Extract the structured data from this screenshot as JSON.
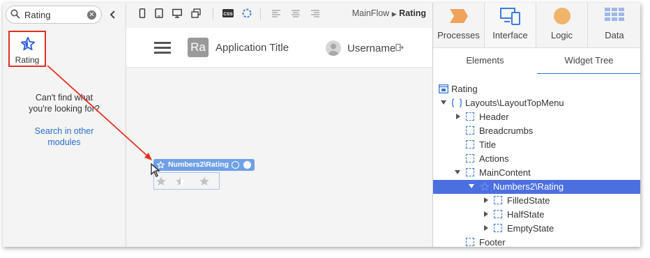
{
  "left_panel": {
    "search_value": "Rating",
    "widget_label": "Rating",
    "not_found_line1": "Can't find what",
    "not_found_line2": "you're looking for?",
    "search_other_line1": "Search in other",
    "search_other_line2": "modules"
  },
  "canvas": {
    "breadcrumb_flow": "MainFlow",
    "breadcrumb_screen": "Rating",
    "logo_text": "Ra",
    "app_title": "Application Title",
    "username": "Username",
    "widget_tag": "Numbers2\\Rating"
  },
  "right_panel": {
    "tabs": [
      {
        "label": "Processes"
      },
      {
        "label": "Interface"
      },
      {
        "label": "Logic"
      },
      {
        "label": "Data"
      }
    ],
    "subtabs": [
      {
        "label": "Elements"
      },
      {
        "label": "Widget Tree"
      }
    ],
    "tree": [
      {
        "label": "Rating"
      },
      {
        "label": "Layouts\\LayoutTopMenu"
      },
      {
        "label": "Header"
      },
      {
        "label": "Breadcrumbs"
      },
      {
        "label": "Title"
      },
      {
        "label": "Actions"
      },
      {
        "label": "MainContent"
      },
      {
        "label": "Numbers2\\Rating"
      },
      {
        "label": "FilledState"
      },
      {
        "label": "HalfState"
      },
      {
        "label": "EmptyState"
      },
      {
        "label": "Footer"
      }
    ]
  },
  "colors": {
    "accent_blue": "#2a6fc9",
    "selection_blue": "#4c6fe0",
    "highlight_red": "#e0311f",
    "widget_tag": "#6fa0e8"
  },
  "icons": [
    "search-icon",
    "clear-icon",
    "chevron-left-icon",
    "star-icon",
    "phone-icon",
    "tablet-icon",
    "desktop-icon",
    "layers-icon",
    "css-icon",
    "spinner-icon",
    "align-left-icon",
    "align-center-icon",
    "align-right-icon",
    "hamburger-icon",
    "user-icon",
    "logout-icon",
    "processes-icon",
    "interface-icon",
    "logic-icon",
    "data-icon",
    "screen-icon",
    "layout-icon",
    "container-icon"
  ]
}
